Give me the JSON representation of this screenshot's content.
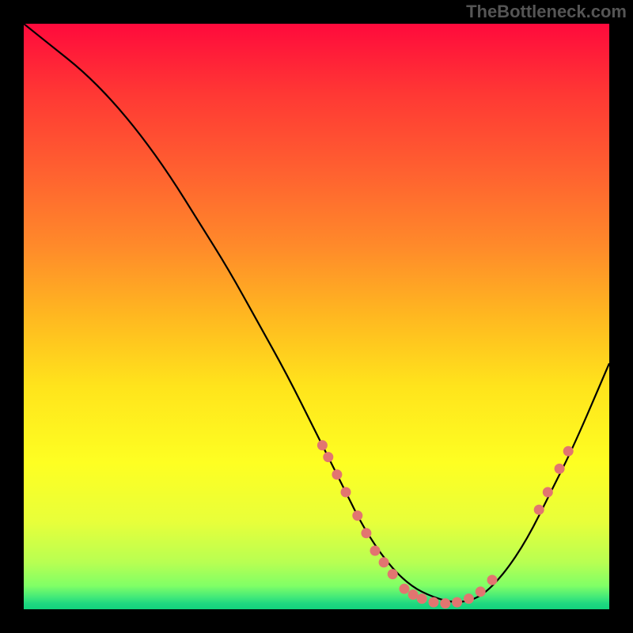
{
  "watermark": "TheBottleneck.com",
  "chart_data": {
    "type": "line",
    "title": "",
    "xlabel": "",
    "ylabel": "",
    "xlim": [
      0,
      100
    ],
    "ylim": [
      0,
      100
    ],
    "series": [
      {
        "name": "curve",
        "x": [
          0,
          5,
          10,
          15,
          20,
          25,
          30,
          35,
          40,
          45,
          50,
          55,
          58,
          62,
          66,
          70,
          74,
          78,
          82,
          86,
          90,
          94,
          100
        ],
        "values": [
          100,
          96,
          92,
          87,
          81,
          74,
          66,
          58,
          49,
          40,
          30,
          20,
          14,
          8,
          4,
          2,
          1,
          2,
          6,
          12,
          20,
          28,
          42
        ]
      }
    ],
    "markers": [
      {
        "x": 51,
        "y": 28
      },
      {
        "x": 52,
        "y": 26
      },
      {
        "x": 53.5,
        "y": 23
      },
      {
        "x": 55,
        "y": 20
      },
      {
        "x": 57,
        "y": 16
      },
      {
        "x": 58.5,
        "y": 13
      },
      {
        "x": 60,
        "y": 10
      },
      {
        "x": 61.5,
        "y": 8
      },
      {
        "x": 63,
        "y": 6
      },
      {
        "x": 65,
        "y": 3.5
      },
      {
        "x": 66.5,
        "y": 2.5
      },
      {
        "x": 68,
        "y": 1.8
      },
      {
        "x": 70,
        "y": 1.2
      },
      {
        "x": 72,
        "y": 1.0
      },
      {
        "x": 74,
        "y": 1.2
      },
      {
        "x": 76,
        "y": 1.8
      },
      {
        "x": 78,
        "y": 3.0
      },
      {
        "x": 80,
        "y": 5.0
      },
      {
        "x": 88,
        "y": 17
      },
      {
        "x": 89.5,
        "y": 20
      },
      {
        "x": 91.5,
        "y": 24
      },
      {
        "x": 93,
        "y": 27
      }
    ],
    "marker_color": "#e27570",
    "curve_color": "#000000"
  }
}
